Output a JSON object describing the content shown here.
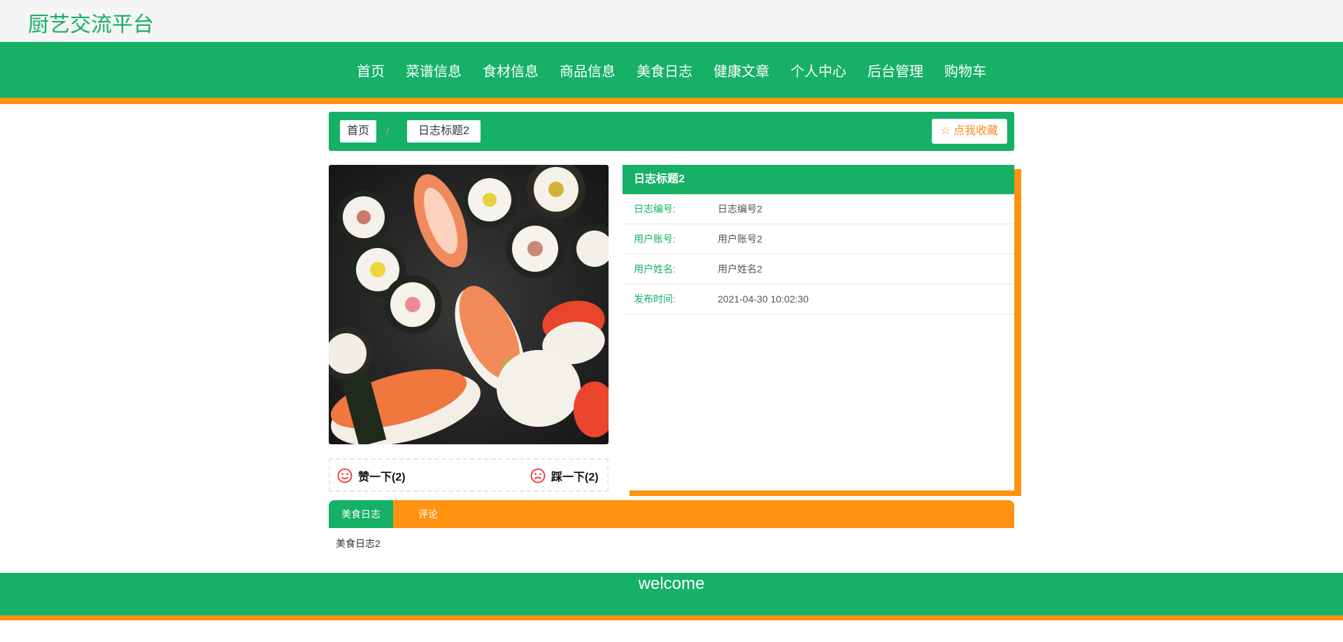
{
  "site": {
    "title": "厨艺交流平台"
  },
  "nav": {
    "items": [
      "首页",
      "菜谱信息",
      "食材信息",
      "商品信息",
      "美食日志",
      "健康文章",
      "个人中心",
      "后台管理",
      "购物车"
    ]
  },
  "breadcrumb": {
    "home": "首页",
    "separator": "/",
    "current": "日志标题2",
    "favorite_label": "点我收藏"
  },
  "votes": {
    "like_label": "赞一下(2)",
    "dislike_label": "踩一下(2)"
  },
  "detail": {
    "title": "日志标题2",
    "fields": [
      {
        "label": "日志编号:",
        "value": "日志编号2"
      },
      {
        "label": "用户账号:",
        "value": "用户账号2"
      },
      {
        "label": "用户姓名:",
        "value": "用户姓名2"
      },
      {
        "label": "发布时间:",
        "value": "2021-04-30 10:02:30"
      }
    ]
  },
  "tabs": {
    "items": [
      "美食日志",
      "评论"
    ],
    "active_index": 0,
    "content": "美食日志2"
  },
  "footer": {
    "text": "welcome"
  },
  "colors": {
    "primary": "#16b066",
    "accent": "#ff9311"
  },
  "icons": {
    "favorite": "star-outline-icon",
    "like": "smile-icon",
    "dislike": "frown-icon"
  }
}
